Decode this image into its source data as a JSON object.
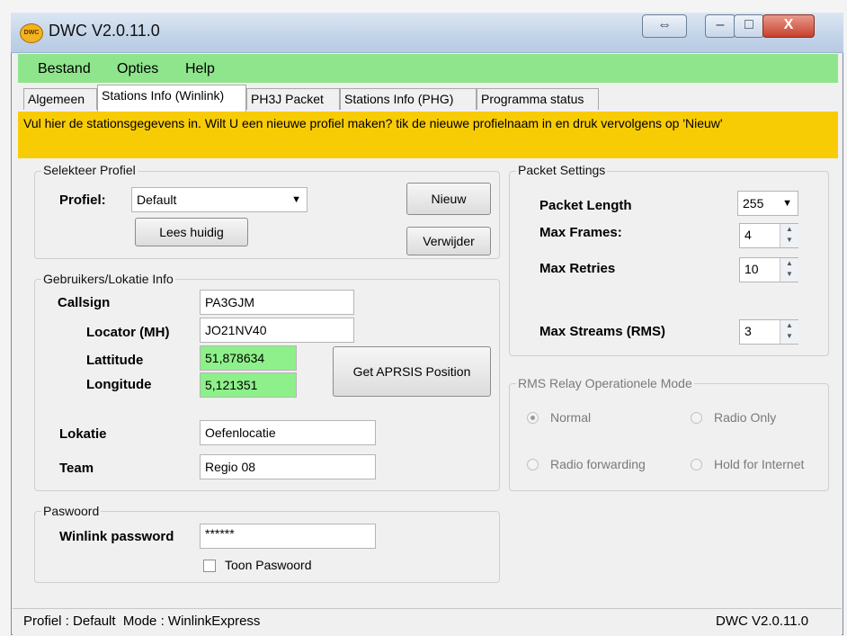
{
  "window": {
    "title": "DWC V2.0.11.0",
    "icon_text": "DWC"
  },
  "caption_buttons": {
    "resize": "⇔",
    "minimize": "–",
    "maximize": "□",
    "close": "X"
  },
  "menu": [
    "Bestand",
    "Opties",
    "Help"
  ],
  "tabs": [
    "Algemeen",
    "Stations Info (Winlink)",
    "PH3J Packet",
    "Stations Info (PHG)",
    "Programma status"
  ],
  "active_tab": "Stations Info (Winlink)",
  "banner": "Vul hier de stationsgegevens in. Wilt U een nieuwe profiel maken? tik de nieuwe profielnaam in en druk vervolgens op 'Nieuw'",
  "profile": {
    "group_label": "Selekteer Profiel",
    "label": "Profiel:",
    "value": "Default",
    "new_button": "Nieuw",
    "read_button": "Lees huidig",
    "delete_button": "Verwijder"
  },
  "user": {
    "group_label": "Gebruikers/Lokatie Info",
    "callsign_label": "Callsign",
    "callsign": "PA3GJM",
    "locator_label": "Locator (MH)",
    "locator": "JO21NV40",
    "lat_label": "Lattitude",
    "lat": "51,878634",
    "lon_label": "Longitude",
    "lon": "5,121351",
    "aprs_button": "Get APRSIS Position",
    "location_label": "Lokatie",
    "location": "Oefenlocatie",
    "team_label": "Team",
    "team": "Regio 08"
  },
  "password": {
    "group_label": "Paswoord",
    "label": "Winlink password",
    "value": "******",
    "show_label": "Toon Paswoord",
    "show_checked": false
  },
  "packet": {
    "group_label": "Packet Settings",
    "length_label": "Packet Length",
    "length": "255",
    "frames_label": "Max Frames:",
    "frames": "4",
    "retries_label": "Max Retries",
    "retries": "10",
    "streams_label": "Max Streams (RMS)",
    "streams": "3"
  },
  "rms": {
    "group_label": "RMS Relay Operationele Mode",
    "options": [
      "Normal",
      "Radio Only",
      "Radio forwarding",
      "Hold for Internet"
    ],
    "selected": "Normal"
  },
  "status": {
    "left": "Profiel : Default  Mode : WinlinkExpress",
    "right": "DWC V2.0.11.0"
  },
  "colors": {
    "menu_bg": "#8ee58c",
    "banner_bg": "#f8cc04",
    "field_green": "#8ef08a"
  }
}
